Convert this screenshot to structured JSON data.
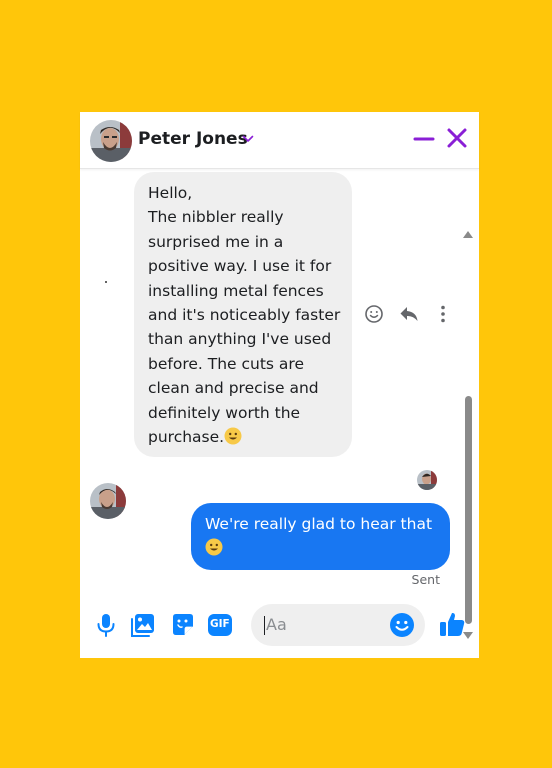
{
  "header": {
    "contact_name": "Peter Jones",
    "icons": [
      "avatar",
      "chevron-down-icon",
      "minimize-icon",
      "close-icon"
    ]
  },
  "colors": {
    "background": "#FFC60A",
    "accent": "#8A1FD6",
    "outgoing_bubble": "#1877F2",
    "incoming_bubble": "#EFEFEF",
    "messenger_blue": "#0B84FF"
  },
  "messages": {
    "incoming": {
      "text": "Hello,\nThe nibbler really surprised me in a positive way. I use it for installing metal fences and it's noticeably faster than anything I've used before. The cuts are clean and precise and definitely worth the purchase.",
      "trailing_emoji": "smiling-face-emoji",
      "actions": [
        "react-icon",
        "reply-icon",
        "more-options-icon"
      ]
    },
    "outgoing": {
      "text": "We're really glad to hear that",
      "trailing_emoji": "smiling-face-emoji",
      "status": "Sent"
    }
  },
  "composer": {
    "placeholder": "Aa",
    "icons": [
      "microphone-icon",
      "photo-icon",
      "sticker-icon",
      "gif-icon",
      "emoji-icon",
      "thumbs-up-icon"
    ],
    "gif_label": "GIF"
  }
}
